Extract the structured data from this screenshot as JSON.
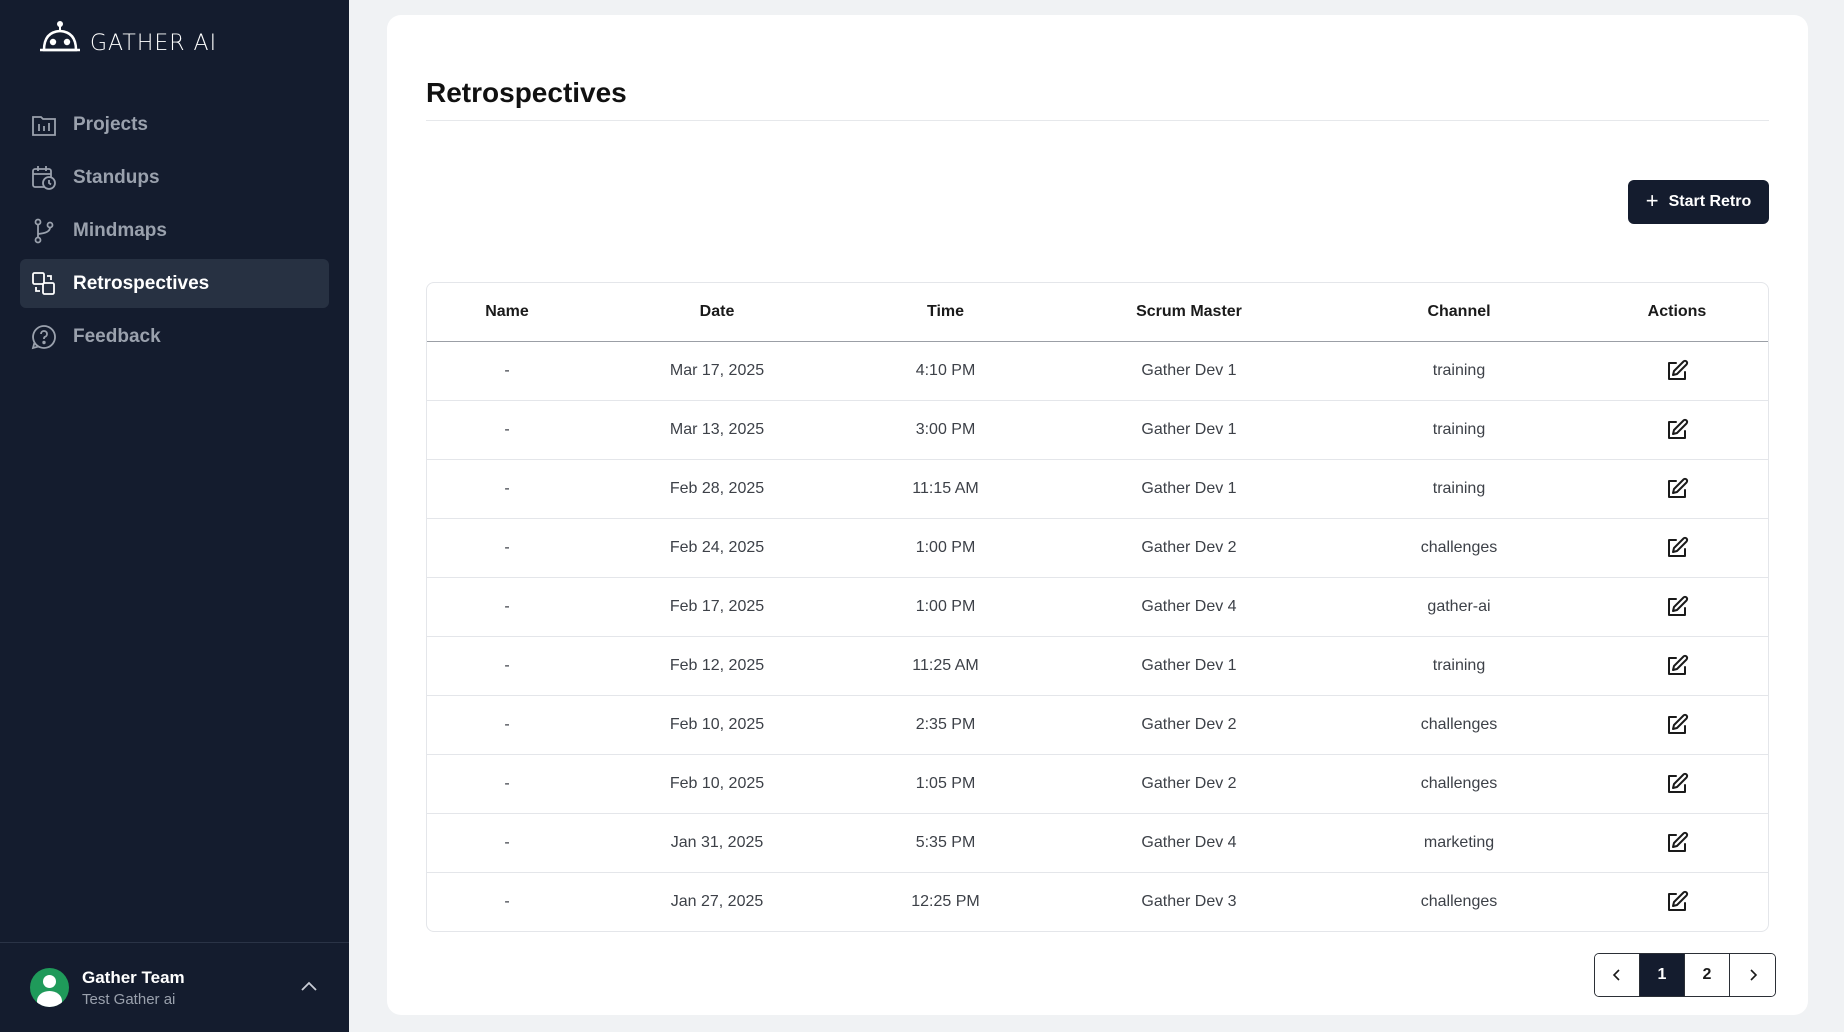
{
  "app": {
    "name": "GATHER AI"
  },
  "sidebar": {
    "items": [
      {
        "label": "Projects",
        "icon": "projects-icon"
      },
      {
        "label": "Standups",
        "icon": "standups-icon"
      },
      {
        "label": "Mindmaps",
        "icon": "mindmaps-icon"
      },
      {
        "label": "Retrospectives",
        "icon": "retrospectives-icon",
        "active": true
      },
      {
        "label": "Feedback",
        "icon": "feedback-icon"
      }
    ]
  },
  "user": {
    "name": "Gather Team",
    "subtitle": "Test Gather ai"
  },
  "main": {
    "title": "Retrospectives",
    "start_button_label": "Start Retro",
    "table": {
      "headers": [
        "Name",
        "Date",
        "Time",
        "Scrum Master",
        "Channel",
        "Actions"
      ],
      "rows": [
        {
          "name": "-",
          "date": "Mar 17, 2025",
          "time": "4:10 PM",
          "scrum_master": "Gather Dev 1",
          "channel": "training"
        },
        {
          "name": "-",
          "date": "Mar 13, 2025",
          "time": "3:00 PM",
          "scrum_master": "Gather Dev 1",
          "channel": "training"
        },
        {
          "name": "-",
          "date": "Feb 28, 2025",
          "time": "11:15 AM",
          "scrum_master": "Gather Dev 1",
          "channel": "training"
        },
        {
          "name": "-",
          "date": "Feb 24, 2025",
          "time": "1:00 PM",
          "scrum_master": "Gather Dev 2",
          "channel": "challenges"
        },
        {
          "name": "-",
          "date": "Feb 17, 2025",
          "time": "1:00 PM",
          "scrum_master": "Gather Dev 4",
          "channel": "gather-ai"
        },
        {
          "name": "-",
          "date": "Feb 12, 2025",
          "time": "11:25 AM",
          "scrum_master": "Gather Dev 1",
          "channel": "training"
        },
        {
          "name": "-",
          "date": "Feb 10, 2025",
          "time": "2:35 PM",
          "scrum_master": "Gather Dev 2",
          "channel": "challenges"
        },
        {
          "name": "-",
          "date": "Feb 10, 2025",
          "time": "1:05 PM",
          "scrum_master": "Gather Dev 2",
          "channel": "challenges"
        },
        {
          "name": "-",
          "date": "Jan 31, 2025",
          "time": "5:35 PM",
          "scrum_master": "Gather Dev 4",
          "channel": "marketing"
        },
        {
          "name": "-",
          "date": "Jan 27, 2025",
          "time": "12:25 PM",
          "scrum_master": "Gather Dev 3",
          "channel": "challenges"
        }
      ]
    },
    "pagination": {
      "pages": [
        "1",
        "2"
      ],
      "current": "1"
    }
  },
  "colors": {
    "sidebar_bg": "#141c2e",
    "sidebar_active_bg": "#273142",
    "accent": "#141c2e",
    "avatar": "#1f9a5a",
    "page_bg": "#f0f2f4"
  }
}
